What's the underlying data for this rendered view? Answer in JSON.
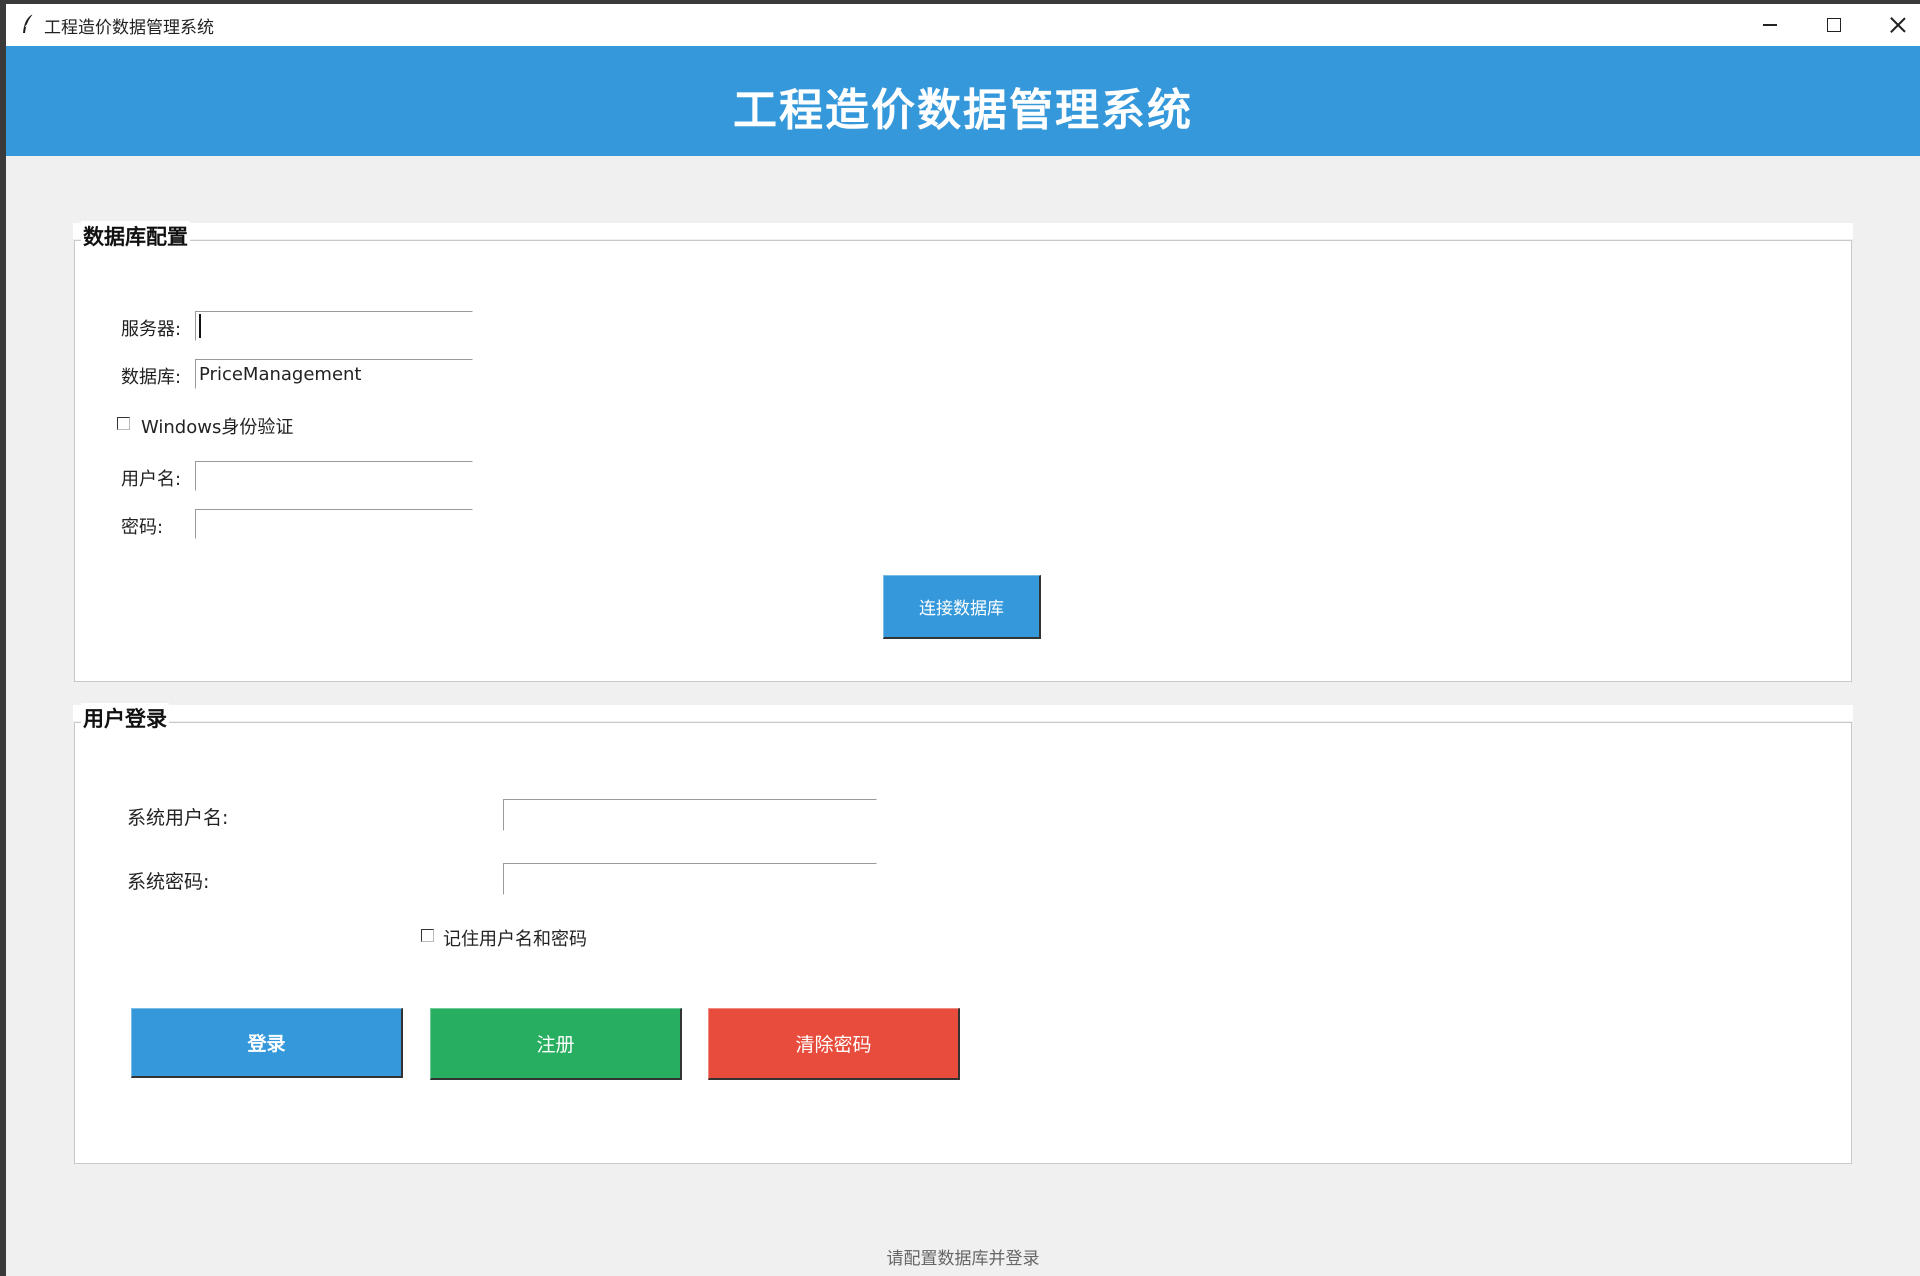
{
  "window": {
    "title": "工程造价数据管理系统"
  },
  "header": {
    "title": "工程造价数据管理系统",
    "background": "#3498db"
  },
  "db_config": {
    "group_title": "数据库配置",
    "server_label": "服务器:",
    "server_value": "",
    "database_label": "数据库:",
    "database_value": "PriceManagement",
    "windows_auth_label": "Windows身份验证",
    "windows_auth_checked": false,
    "username_label": "用户名:",
    "username_value": "",
    "password_label": "密码:",
    "password_value": "",
    "connect_button": "连接数据库"
  },
  "login": {
    "group_title": "用户登录",
    "sys_username_label": "系统用户名:",
    "sys_username_value": "",
    "sys_password_label": "系统密码:",
    "sys_password_value": "",
    "remember_label": "记住用户名和密码",
    "remember_checked": false,
    "login_button": "登录",
    "register_button": "注册",
    "clear_password_button": "清除密码"
  },
  "status_text": "请配置数据库并登录",
  "colors": {
    "blue": "#3498db",
    "green": "#27ae60",
    "red": "#e74c3c"
  },
  "icons": {
    "app": "feather-icon",
    "minimize": "minimize-icon",
    "maximize": "maximize-icon",
    "close": "close-icon"
  }
}
